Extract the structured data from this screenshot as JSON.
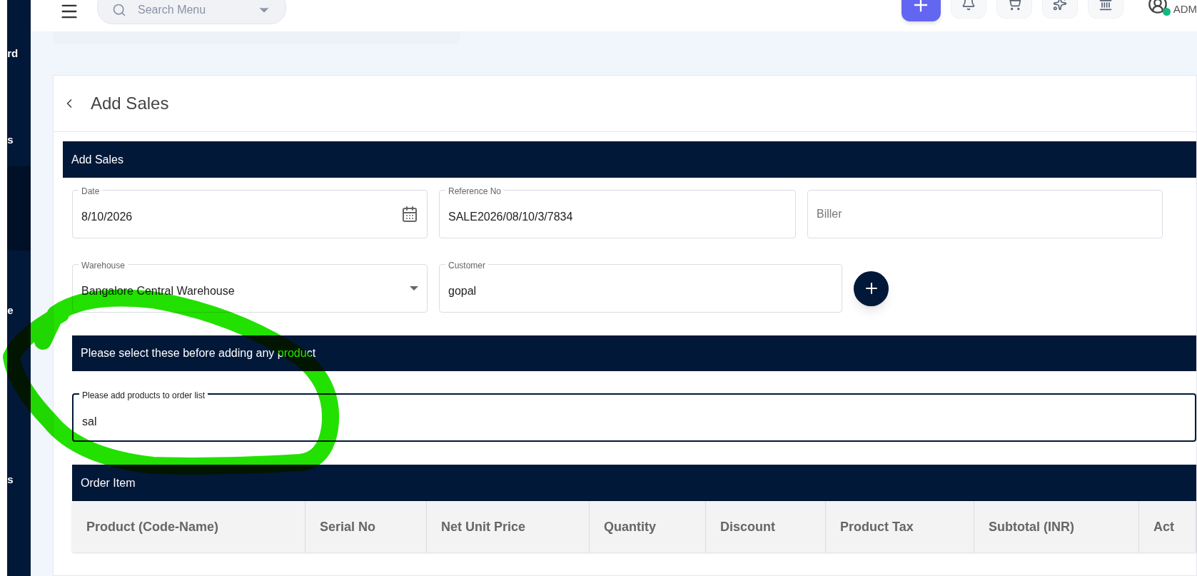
{
  "sidebar": {
    "items": [
      {
        "label": "rd",
        "selected": false
      },
      {
        "label": "s",
        "selected": false
      },
      {
        "selected": true
      },
      {
        "label": "e",
        "selected": false
      },
      {
        "label": "s",
        "selected": false
      }
    ]
  },
  "topbar": {
    "search": {
      "placeholder": "Search Menu"
    },
    "user": {
      "role": "ADM",
      "online": true
    }
  },
  "page": {
    "title": "Add Sales"
  },
  "form": {
    "section_title": "Add Sales",
    "fields": [
      {
        "label": "Date",
        "value": "8/10/2026",
        "kind": "date"
      },
      {
        "label": "Reference No",
        "value": "SALE2026/08/10/3/7834",
        "kind": "text"
      },
      {
        "placeholder": "Biller",
        "kind": "text"
      },
      {
        "label": "Warehouse",
        "value": "Bangalore Central Warehouse",
        "kind": "select"
      },
      {
        "label": "Customer",
        "value": "gopal",
        "kind": "text"
      }
    ],
    "notice": "Please select these before adding any product",
    "product_search": {
      "label": "Please add products to order list",
      "value": "sal"
    }
  },
  "order_items": {
    "title": "Order Item",
    "columns": [
      "Product (Code-Name)",
      "Serial No",
      "Net Unit Price",
      "Quantity",
      "Discount",
      "Product Tax",
      "Subtotal (INR)",
      "Act"
    ]
  }
}
